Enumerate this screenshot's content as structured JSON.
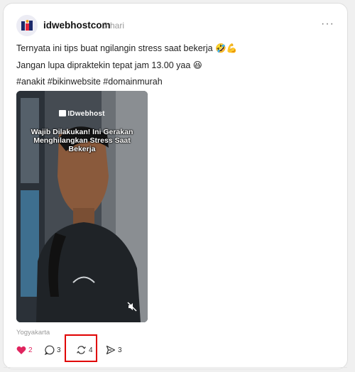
{
  "post": {
    "username": "idwebhostcom",
    "time": "3 hari",
    "more_label": "···",
    "lines": [
      "Ternyata ini tips buat ngilangin stress saat bekerja 🤣💪",
      "Jangan lupa dipraktekin tepat jam 13.00 yaa 😆",
      "#anakit #bikinwebsite #domainmurah"
    ],
    "location": "Yogyakarta",
    "avatar_icon": "idwebhost-logo-icon"
  },
  "video": {
    "brand": "IDwebhost",
    "title": "Wajib Dilakukan! Ini Gerakan Menghilangkan Stress Saat Bekerja",
    "mute_icon": "speaker-muted-icon"
  },
  "actions": {
    "like": {
      "icon": "heart-icon",
      "count": "2",
      "liked": true,
      "color": "#e0245e"
    },
    "reply": {
      "icon": "comment-icon",
      "count": "3"
    },
    "repost": {
      "icon": "repost-icon",
      "count": "4"
    },
    "share": {
      "icon": "send-icon",
      "count": "3"
    }
  },
  "colors": {
    "highlight": "#e00000",
    "text": "#1a1a1a",
    "muted": "#9a9a9a"
  }
}
